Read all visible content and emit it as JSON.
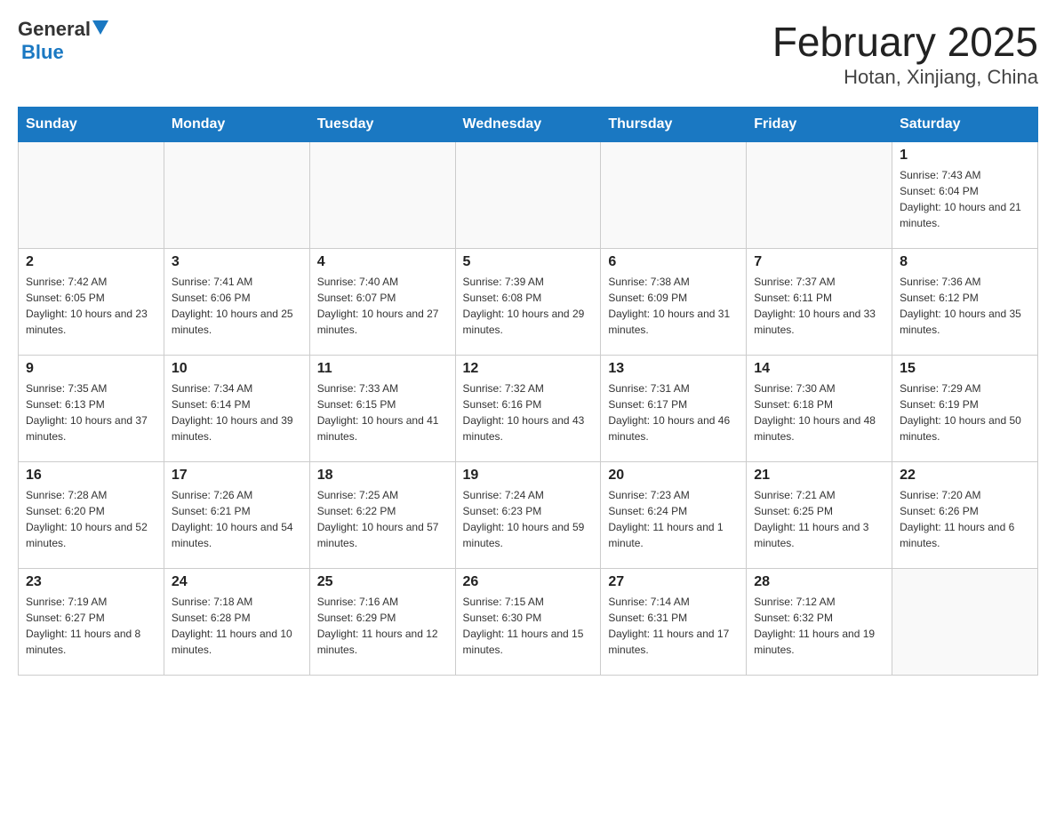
{
  "header": {
    "logo_general": "General",
    "logo_blue": "Blue",
    "title": "February 2025",
    "subtitle": "Hotan, Xinjiang, China"
  },
  "weekdays": [
    "Sunday",
    "Monday",
    "Tuesday",
    "Wednesday",
    "Thursday",
    "Friday",
    "Saturday"
  ],
  "weeks": [
    [
      {
        "day": "",
        "sunrise": "",
        "sunset": "",
        "daylight": ""
      },
      {
        "day": "",
        "sunrise": "",
        "sunset": "",
        "daylight": ""
      },
      {
        "day": "",
        "sunrise": "",
        "sunset": "",
        "daylight": ""
      },
      {
        "day": "",
        "sunrise": "",
        "sunset": "",
        "daylight": ""
      },
      {
        "day": "",
        "sunrise": "",
        "sunset": "",
        "daylight": ""
      },
      {
        "day": "",
        "sunrise": "",
        "sunset": "",
        "daylight": ""
      },
      {
        "day": "1",
        "sunrise": "Sunrise: 7:43 AM",
        "sunset": "Sunset: 6:04 PM",
        "daylight": "Daylight: 10 hours and 21 minutes."
      }
    ],
    [
      {
        "day": "2",
        "sunrise": "Sunrise: 7:42 AM",
        "sunset": "Sunset: 6:05 PM",
        "daylight": "Daylight: 10 hours and 23 minutes."
      },
      {
        "day": "3",
        "sunrise": "Sunrise: 7:41 AM",
        "sunset": "Sunset: 6:06 PM",
        "daylight": "Daylight: 10 hours and 25 minutes."
      },
      {
        "day": "4",
        "sunrise": "Sunrise: 7:40 AM",
        "sunset": "Sunset: 6:07 PM",
        "daylight": "Daylight: 10 hours and 27 minutes."
      },
      {
        "day": "5",
        "sunrise": "Sunrise: 7:39 AM",
        "sunset": "Sunset: 6:08 PM",
        "daylight": "Daylight: 10 hours and 29 minutes."
      },
      {
        "day": "6",
        "sunrise": "Sunrise: 7:38 AM",
        "sunset": "Sunset: 6:09 PM",
        "daylight": "Daylight: 10 hours and 31 minutes."
      },
      {
        "day": "7",
        "sunrise": "Sunrise: 7:37 AM",
        "sunset": "Sunset: 6:11 PM",
        "daylight": "Daylight: 10 hours and 33 minutes."
      },
      {
        "day": "8",
        "sunrise": "Sunrise: 7:36 AM",
        "sunset": "Sunset: 6:12 PM",
        "daylight": "Daylight: 10 hours and 35 minutes."
      }
    ],
    [
      {
        "day": "9",
        "sunrise": "Sunrise: 7:35 AM",
        "sunset": "Sunset: 6:13 PM",
        "daylight": "Daylight: 10 hours and 37 minutes."
      },
      {
        "day": "10",
        "sunrise": "Sunrise: 7:34 AM",
        "sunset": "Sunset: 6:14 PM",
        "daylight": "Daylight: 10 hours and 39 minutes."
      },
      {
        "day": "11",
        "sunrise": "Sunrise: 7:33 AM",
        "sunset": "Sunset: 6:15 PM",
        "daylight": "Daylight: 10 hours and 41 minutes."
      },
      {
        "day": "12",
        "sunrise": "Sunrise: 7:32 AM",
        "sunset": "Sunset: 6:16 PM",
        "daylight": "Daylight: 10 hours and 43 minutes."
      },
      {
        "day": "13",
        "sunrise": "Sunrise: 7:31 AM",
        "sunset": "Sunset: 6:17 PM",
        "daylight": "Daylight: 10 hours and 46 minutes."
      },
      {
        "day": "14",
        "sunrise": "Sunrise: 7:30 AM",
        "sunset": "Sunset: 6:18 PM",
        "daylight": "Daylight: 10 hours and 48 minutes."
      },
      {
        "day": "15",
        "sunrise": "Sunrise: 7:29 AM",
        "sunset": "Sunset: 6:19 PM",
        "daylight": "Daylight: 10 hours and 50 minutes."
      }
    ],
    [
      {
        "day": "16",
        "sunrise": "Sunrise: 7:28 AM",
        "sunset": "Sunset: 6:20 PM",
        "daylight": "Daylight: 10 hours and 52 minutes."
      },
      {
        "day": "17",
        "sunrise": "Sunrise: 7:26 AM",
        "sunset": "Sunset: 6:21 PM",
        "daylight": "Daylight: 10 hours and 54 minutes."
      },
      {
        "day": "18",
        "sunrise": "Sunrise: 7:25 AM",
        "sunset": "Sunset: 6:22 PM",
        "daylight": "Daylight: 10 hours and 57 minutes."
      },
      {
        "day": "19",
        "sunrise": "Sunrise: 7:24 AM",
        "sunset": "Sunset: 6:23 PM",
        "daylight": "Daylight: 10 hours and 59 minutes."
      },
      {
        "day": "20",
        "sunrise": "Sunrise: 7:23 AM",
        "sunset": "Sunset: 6:24 PM",
        "daylight": "Daylight: 11 hours and 1 minute."
      },
      {
        "day": "21",
        "sunrise": "Sunrise: 7:21 AM",
        "sunset": "Sunset: 6:25 PM",
        "daylight": "Daylight: 11 hours and 3 minutes."
      },
      {
        "day": "22",
        "sunrise": "Sunrise: 7:20 AM",
        "sunset": "Sunset: 6:26 PM",
        "daylight": "Daylight: 11 hours and 6 minutes."
      }
    ],
    [
      {
        "day": "23",
        "sunrise": "Sunrise: 7:19 AM",
        "sunset": "Sunset: 6:27 PM",
        "daylight": "Daylight: 11 hours and 8 minutes."
      },
      {
        "day": "24",
        "sunrise": "Sunrise: 7:18 AM",
        "sunset": "Sunset: 6:28 PM",
        "daylight": "Daylight: 11 hours and 10 minutes."
      },
      {
        "day": "25",
        "sunrise": "Sunrise: 7:16 AM",
        "sunset": "Sunset: 6:29 PM",
        "daylight": "Daylight: 11 hours and 12 minutes."
      },
      {
        "day": "26",
        "sunrise": "Sunrise: 7:15 AM",
        "sunset": "Sunset: 6:30 PM",
        "daylight": "Daylight: 11 hours and 15 minutes."
      },
      {
        "day": "27",
        "sunrise": "Sunrise: 7:14 AM",
        "sunset": "Sunset: 6:31 PM",
        "daylight": "Daylight: 11 hours and 17 minutes."
      },
      {
        "day": "28",
        "sunrise": "Sunrise: 7:12 AM",
        "sunset": "Sunset: 6:32 PM",
        "daylight": "Daylight: 11 hours and 19 minutes."
      },
      {
        "day": "",
        "sunrise": "",
        "sunset": "",
        "daylight": ""
      }
    ]
  ]
}
